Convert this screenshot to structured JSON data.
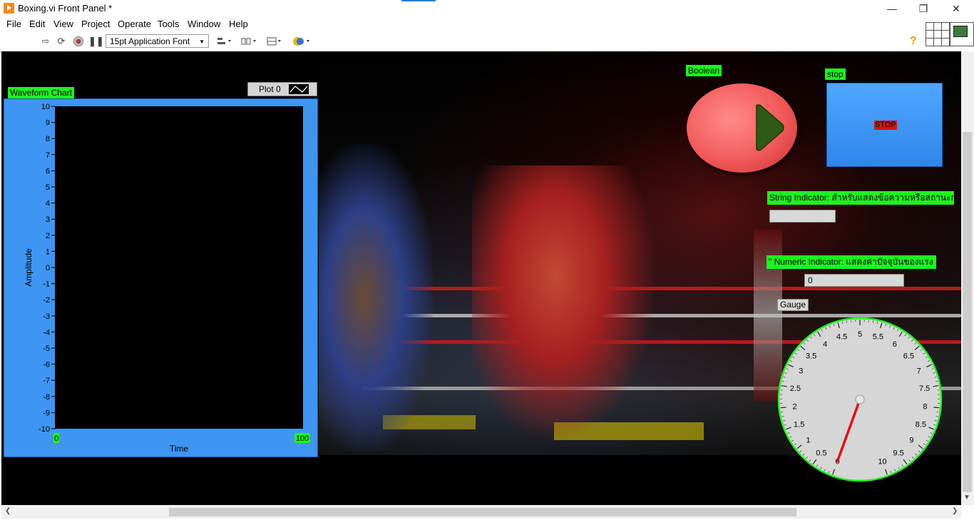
{
  "window": {
    "title": "Boxing.vi Front Panel *",
    "minimize": "—",
    "restore": "❐",
    "close": "✕"
  },
  "menu": [
    "File",
    "Edit",
    "View",
    "Project",
    "Operate",
    "Tools",
    "Window",
    "Help"
  ],
  "toolbar": {
    "font": "15pt Application Font",
    "help": "?",
    "icons": [
      "run-arrow-icon",
      "run-continuously-icon",
      "abort-icon",
      "pause-icon",
      "align-icon",
      "distribute-icon",
      "resize-icon",
      "reorder-icon"
    ]
  },
  "waveform_chart": {
    "label": "Waveform Chart",
    "legend_plot": "Plot 0",
    "xlabel": "Time",
    "ylabel": "Amplitude",
    "x_min": "0",
    "x_max": "100",
    "y_ticks": [
      "10",
      "9",
      "8",
      "7",
      "6",
      "5",
      "4",
      "3",
      "2",
      "1",
      "0",
      "-1",
      "-2",
      "-3",
      "-4",
      "-5",
      "-6",
      "-7",
      "-8",
      "-9",
      "-10"
    ]
  },
  "chart_data": {
    "type": "line",
    "title": "",
    "xlabel": "Time",
    "ylabel": "Amplitude",
    "xlim": [
      0,
      100
    ],
    "ylim": [
      -10,
      10
    ],
    "series": [],
    "grid": false
  },
  "boolean": {
    "label": "Boolean"
  },
  "stop": {
    "label": "stop",
    "button_text": "STOP"
  },
  "string_indicator": {
    "label": "String Indicator: สำหรับแสดงข้อความหรือสถานะการวัด",
    "value": ""
  },
  "numeric_indicator": {
    "label": "\" Numeric Indicator: แสดงค่าปัจจุบันของแรง",
    "value": "0"
  },
  "gauge": {
    "label": "Gauge",
    "value": 0,
    "min": 0,
    "max": 10,
    "ticks": [
      "0",
      "0.5",
      "1",
      "1.5",
      "2",
      "2.5",
      "3",
      "3.5",
      "4",
      "4.5",
      "5",
      "5.5",
      "6",
      "6.5",
      "7",
      "7.5",
      "8",
      "8.5",
      "9",
      "9.5",
      "10"
    ]
  },
  "colors": {
    "label_bg": "#1df51d",
    "chart_frame": "#3e95f2",
    "stop_button": "#3a94f5",
    "boolean_button": "#f25a5a",
    "gauge_needle": "#e01010"
  }
}
